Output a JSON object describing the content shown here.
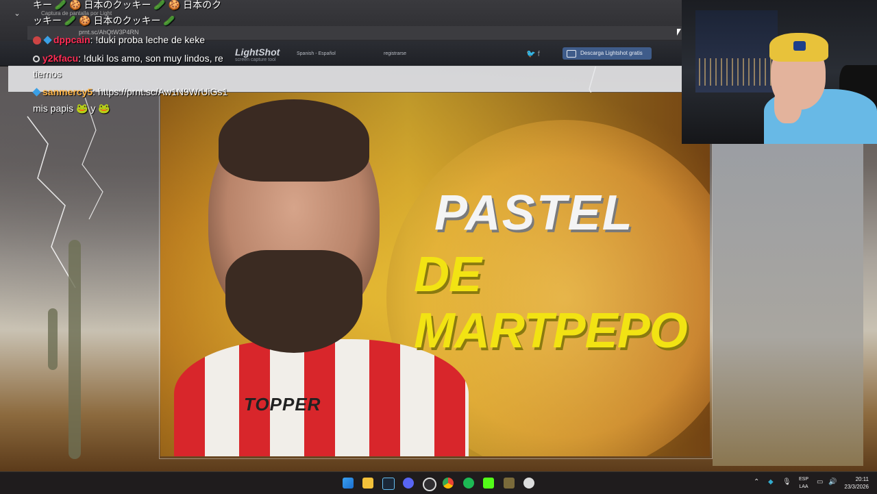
{
  "lightshot": {
    "logo": "LightShot",
    "tagline": "screen capture tool",
    "language": "Spanish - Español",
    "register": "registrarse",
    "download_button": "Descarga Lightshot gratis",
    "tab_caption": "Captura de pantalla por Light",
    "url": "prnt.sc/AhQtW3P4RN",
    "social": [
      "twitter-icon",
      "facebook-icon"
    ]
  },
  "chat": {
    "lines": [
      {
        "user": "",
        "user_color": "#ffffff",
        "text": "キー 🥒 🍪 日本のクッキー 🥒 🍪 日本のク",
        "icons": []
      },
      {
        "user": "",
        "user_color": "#ffffff",
        "text": "ッキー 🥒 🍪 日本のクッキー 🥒",
        "icons": []
      },
      {
        "user": "dppcain",
        "user_color": "#ff2d55",
        "text": ": !duki proba leche de keke"
      },
      {
        "user": "y2kfacu",
        "user_color": "#ff2d55",
        "text": ": !duki los amo, son muy lindos, re"
      },
      {
        "user": "",
        "user_color": "#ffffff",
        "text": "tiernos"
      },
      {
        "user": "sanmercy5",
        "user_color": "#ffb547",
        "text": ": https://prnt.sc/Aw1N9WrUiGs1"
      },
      {
        "user": "",
        "user_color": "#ffffff",
        "text": "mis papis 🐸 y 🐸"
      }
    ]
  },
  "thumbnail": {
    "title_line1": "PASTEL",
    "title_line2": "DE MARTPEPO",
    "shirt_brand": "TOPPER"
  },
  "taskbar": {
    "apps": [
      "windows-start",
      "file-explorer",
      "steam",
      "discord",
      "obs",
      "chrome",
      "spotify",
      "kick",
      "minecraft",
      "ccleaner"
    ],
    "language": "ESP",
    "language_sub": "LAA",
    "time": "20:11",
    "date": "23/3/2026"
  },
  "colors": {
    "accent_blue": "#3f5c8a",
    "chat_username_red": "#ff2d55",
    "title_yellow": "#f2e313"
  }
}
